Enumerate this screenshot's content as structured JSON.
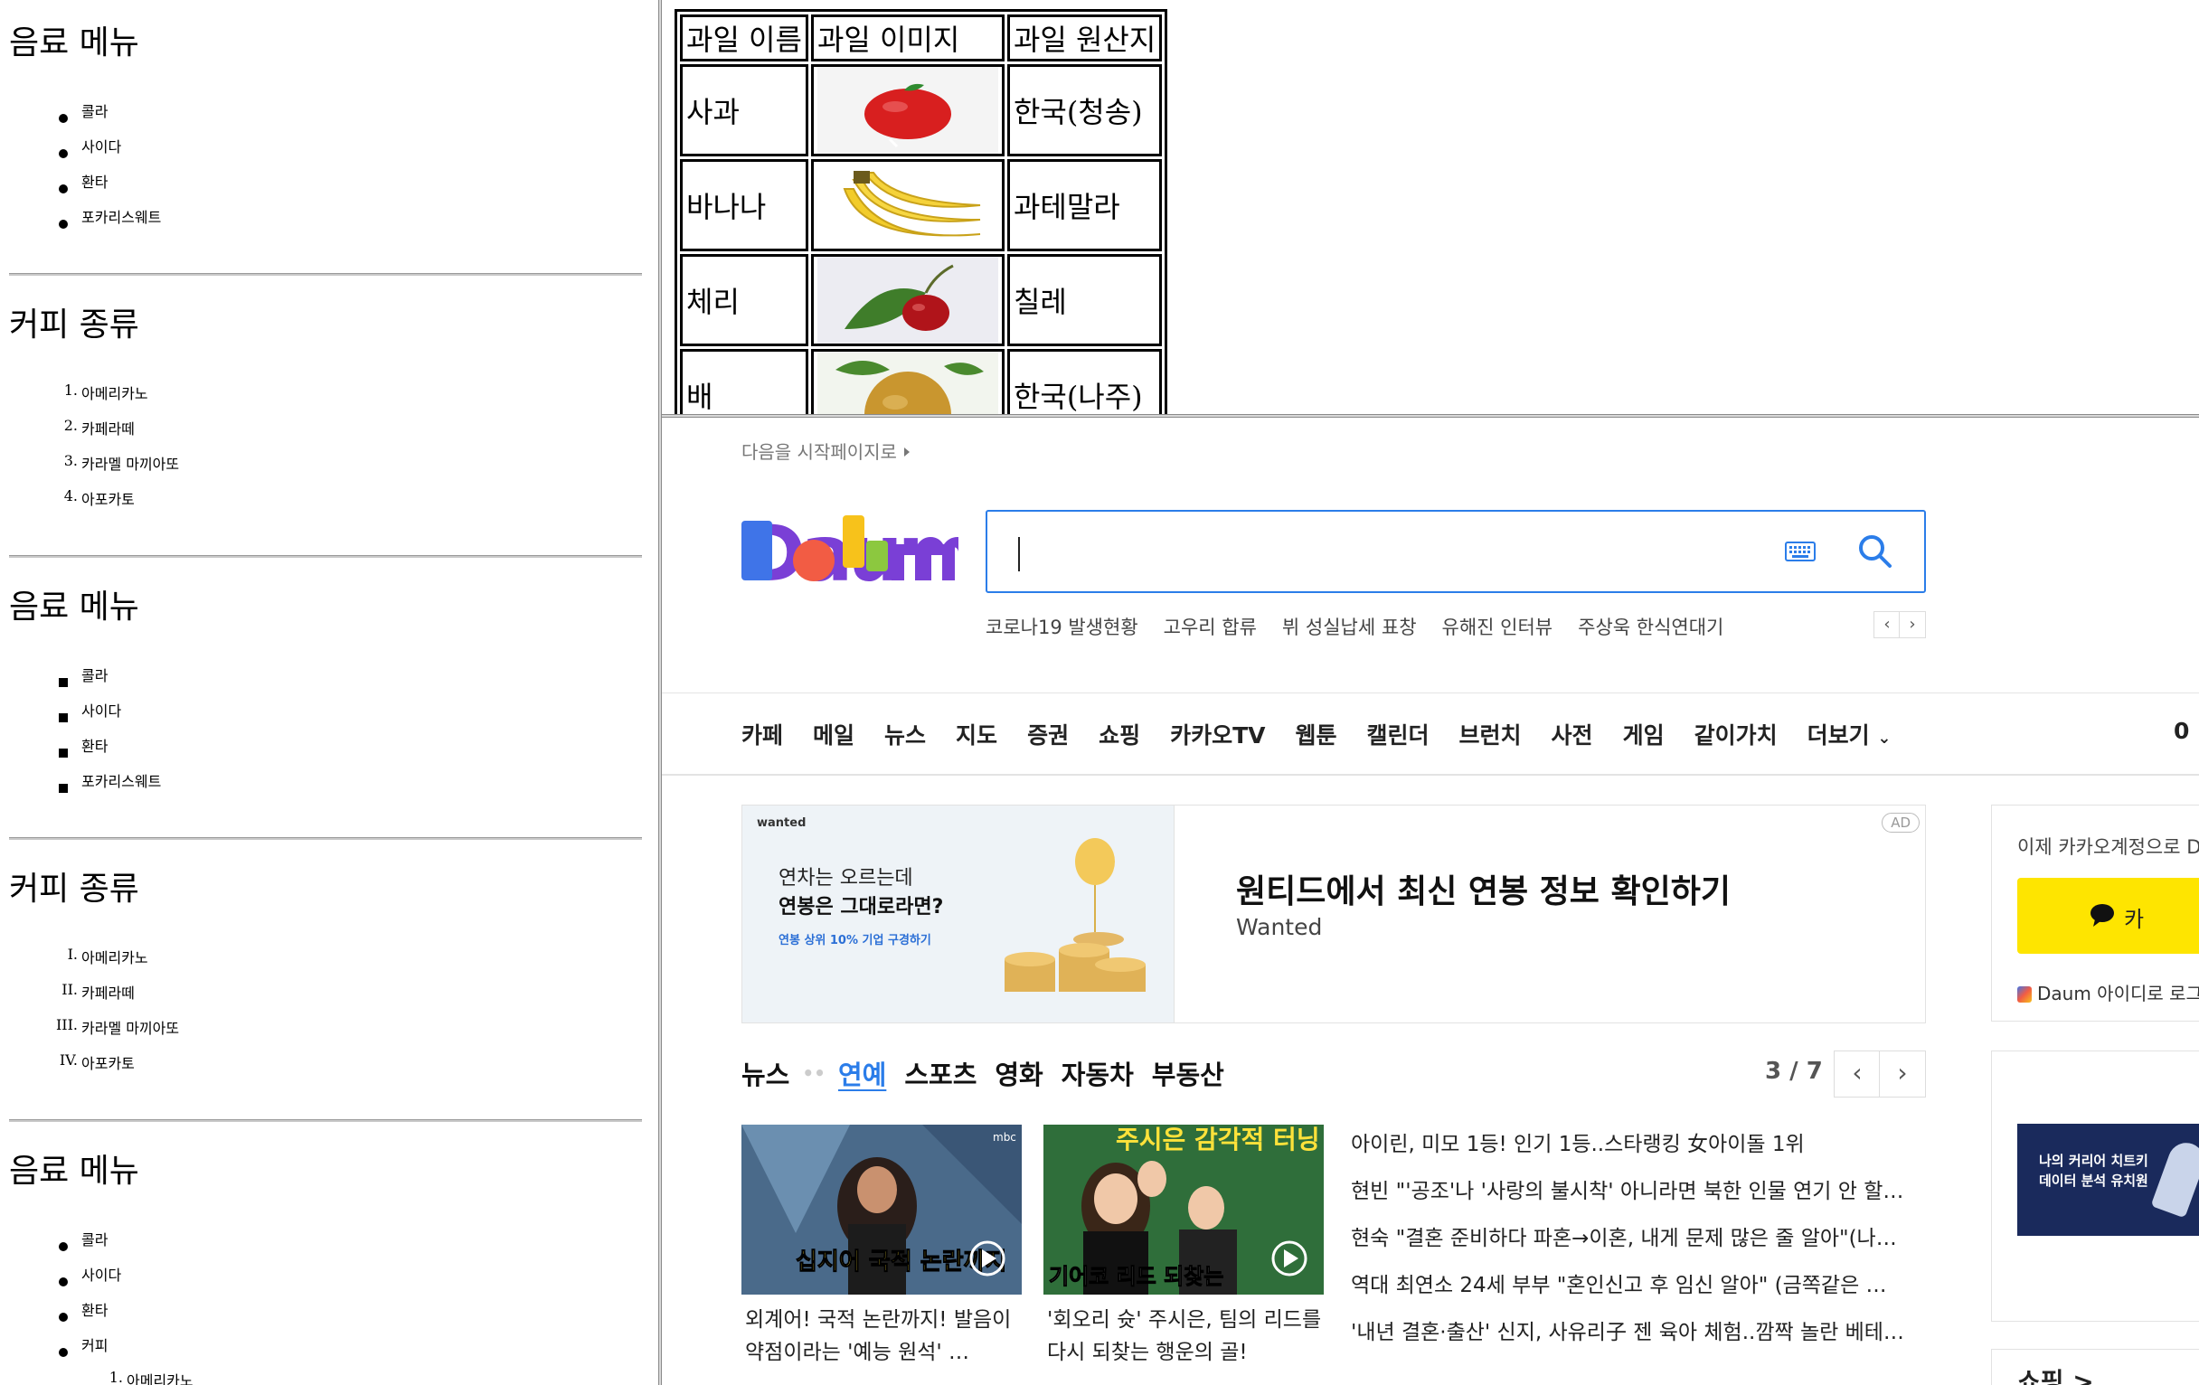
{
  "left": {
    "sections": [
      {
        "title": "음료 메뉴",
        "items": [
          "콜라",
          "사이다",
          "환타",
          "포카리스웨트"
        ]
      },
      {
        "title": "커피 종류",
        "items": [
          "아메리카노",
          "카페라떼",
          "카라멜 마끼아또",
          "아포카토"
        ],
        "numbers": [
          "1.",
          "2.",
          "3.",
          "4."
        ]
      },
      {
        "title": "음료 메뉴",
        "items": [
          "콜라",
          "사이다",
          "환타",
          "포카리스웨트"
        ]
      },
      {
        "title": "커피 종류",
        "items": [
          "아메리카노",
          "카페라떼",
          "카라멜 마끼아또",
          "아포카토"
        ],
        "numbers": [
          "I.",
          "II.",
          "III.",
          "IV."
        ]
      },
      {
        "title": "음료 메뉴",
        "items": [
          "콜라",
          "사이다",
          "환타",
          "커피"
        ],
        "sub_items": [
          "아메리카노"
        ],
        "sub_numbers": [
          "1."
        ]
      }
    ]
  },
  "fruit_table": {
    "headers": [
      "과일 이름",
      "과일 이미지",
      "과일 원산지"
    ],
    "rows": [
      {
        "name": "사과",
        "origin": "한국(청송)",
        "image_icon": "apple-image"
      },
      {
        "name": "바나나",
        "origin": "과테말라",
        "image_icon": "banana-image"
      },
      {
        "name": "체리",
        "origin": "칠레",
        "image_icon": "cherry-image"
      },
      {
        "name": "배",
        "origin": "한국(나주)",
        "image_icon": "pear-image"
      }
    ]
  },
  "daum": {
    "startpage": "다음을 시작페이지로",
    "logo_text": "Daum",
    "search": {
      "value": ""
    },
    "trending": [
      "코로나19 발생현황",
      "고우리 합류",
      "뷔 성실납세 표창",
      "유해진 인터뷰",
      "주상욱 한식연대기"
    ],
    "nav": [
      "카페",
      "메일",
      "뉴스",
      "지도",
      "증권",
      "쇼핑",
      "카카오TV",
      "웹툰",
      "캘린더",
      "브런치",
      "사전",
      "게임",
      "같이가치",
      "더보기"
    ],
    "ad": {
      "brand": "wanted",
      "left_line1": "연차는 오르는데",
      "left_line2": "연봉은 그대로라면?",
      "left_line3": "연봉 상위 10% 기업 구경하기",
      "badge": "AD",
      "title": "원티드에서 최신 연봉 정보 확인하기",
      "subtitle": "Wanted"
    },
    "news_tabs": [
      "뉴스",
      "연예",
      "스포츠",
      "영화",
      "자동차",
      "부동산"
    ],
    "pager": "3 / 7",
    "thumbs": [
      {
        "caption": "외계어! 국적 논란까지! 발음이 약점이라는 '예능 원석' …",
        "overlay": "십지어 국적 논란까지",
        "tag": "mbc"
      },
      {
        "caption": "'회오리 슛' 주시은, 팀의 리드를 다시 되찾는 행운의 골!",
        "overlay": "주시은 감각적 터닝",
        "overlay2": "기어코 리드 되찾는"
      }
    ],
    "headlines": [
      "아이린, 미모 1등! 인기 1등..스타랭킹 女아이돌 1위",
      "현빈 \"'공조'나 '사랑의 불시착' 아니라면 북한 인물 연기 안 할…",
      "현숙 \"결혼 준비하다 파혼→이혼, 내게 문제 많은 줄 알아\"(나…",
      "역대 최연소 24세 부부 \"혼인신고 후 임신 알아\" (금쪽같은 …",
      "'내년 결혼·출산' 신지, 사유리子 젠 육아 체험..깜짝 놀란 베테…"
    ],
    "login": {
      "text": "이제 카카오계정으로 D",
      "kakao_label": "카",
      "daum_id": "Daum 아이디로 로그"
    },
    "side_banner": {
      "line1": "나의 커리어 치트키",
      "line2": "데이터 분석 유치원"
    },
    "shopping": "쇼핑 >",
    "nav_extra": "0"
  },
  "colors": {
    "daum_blue": "#2b7de9",
    "kakao_yellow": "#fee500"
  }
}
